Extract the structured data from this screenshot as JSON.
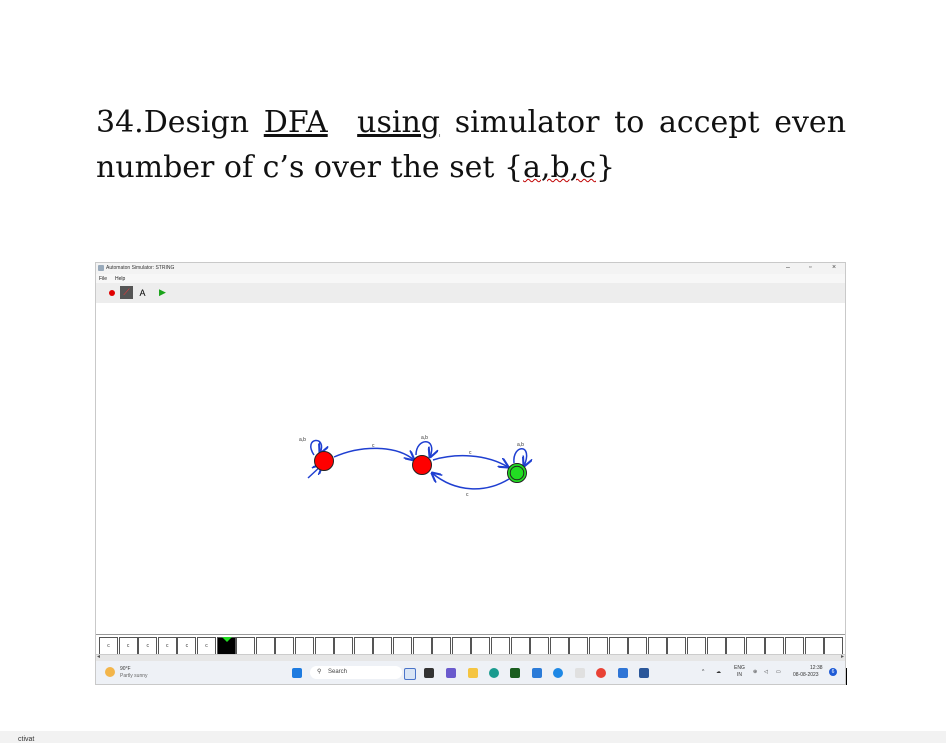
{
  "question": {
    "number": "34.",
    "word1": "Design",
    "dfa": "DFA",
    "using": "using",
    "rest": "simulator to  accept even number of c’s over the set {",
    "set": "a,b,c",
    "close": "}"
  },
  "app": {
    "title": "Automaton Simulator: STRING",
    "menu": [
      "File",
      "Help"
    ],
    "tool_text_label": "A"
  },
  "states": [
    {
      "name": "q0",
      "color": "#ff0000",
      "final": false,
      "initial": true
    },
    {
      "name": "q1",
      "color": "#ff0000",
      "final": false,
      "initial": false
    },
    {
      "name": "q2",
      "color": "#22dd22",
      "final": true,
      "initial": false
    }
  ],
  "transitions": [
    {
      "from": "q0",
      "to": "q0",
      "label": "a,b"
    },
    {
      "from": "q0",
      "to": "q1",
      "label": "c"
    },
    {
      "from": "q1",
      "to": "q1",
      "label": "a,b"
    },
    {
      "from": "q1",
      "to": "q2",
      "label": "c"
    },
    {
      "from": "q2",
      "to": "q2",
      "label": "a,b"
    },
    {
      "from": "q2",
      "to": "q1",
      "label": "c"
    }
  ],
  "tape": {
    "symbols": [
      "c",
      "c",
      "c",
      "c",
      "c",
      "c"
    ],
    "head_index": 6,
    "total_cells": 38
  },
  "taskbar": {
    "weather_temp": "90°F",
    "weather_desc": "Partly sunny",
    "search_placeholder": "Search",
    "lang_top": "ENG",
    "lang_bottom": "IN",
    "time": "12:38",
    "date": "08-08-2023",
    "notification_count": "6"
  },
  "footer": {
    "text": "ctivat"
  }
}
